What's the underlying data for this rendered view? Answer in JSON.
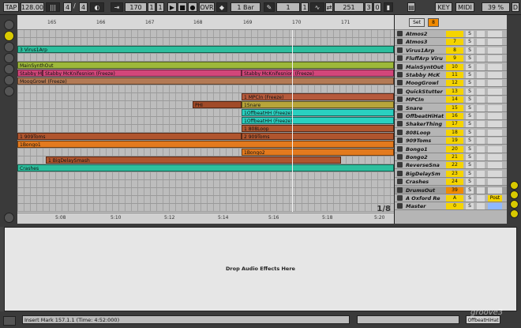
{
  "control_bar": {
    "tap": "TAP",
    "tempo": "128.00",
    "sig_num": "4",
    "sig_slash": "/",
    "sig_den": "4",
    "position_bar": "170",
    "position_beat": "1",
    "position_sub": "1",
    "ovr": "OVR",
    "quantize": "1 Bar",
    "loop_start_bar": "1",
    "loop_start_beat": "1",
    "loop_len_bar": "251",
    "loop_len_beat": "3",
    "loop_len_sub": "0",
    "key": "KEY",
    "midi": "MIDI",
    "cpu": "39 %",
    "d": "D"
  },
  "ruler": [
    "165",
    "166",
    "167",
    "168",
    "169",
    "170",
    "171"
  ],
  "time_ruler": [
    "5:08",
    "5:10",
    "5:12",
    "5:14",
    "5:16",
    "5:18",
    "5:20"
  ],
  "pager": "1/8",
  "set_label": "Set",
  "set_num": "8",
  "clips": [
    {
      "lane": 2,
      "label": "3 Virus1Arp",
      "start": 0,
      "end": 477,
      "color": "#2dbf9e"
    },
    {
      "lane": 4,
      "label": "MainSynthOut",
      "start": 0,
      "end": 477,
      "color": "#9db83a"
    },
    {
      "lane": 5,
      "label": "Stabby Mc",
      "start": 0,
      "end": 32,
      "color": "#d2467a"
    },
    {
      "lane": 5,
      "label": "Stabby McKnifesnion (Freeze)",
      "start": 32,
      "end": 284,
      "color": "#d2467a"
    },
    {
      "lane": 5,
      "label": "Stabby McKnifesnion (Freeze)",
      "start": 284,
      "end": 477,
      "color": "#d2467a"
    },
    {
      "lane": 6,
      "label": "MoogGrowl (Freeze)",
      "start": 0,
      "end": 477,
      "color": "#b37a55"
    },
    {
      "lane": 8,
      "label": "1 MPCIn (Freeze)",
      "start": 284,
      "end": 477,
      "color": "#b55a3c"
    },
    {
      "lane": 9,
      "label": "PHI",
      "start": 222,
      "end": 284,
      "color": "#a04a28"
    },
    {
      "lane": 9,
      "label": "1Snare",
      "start": 284,
      "end": 477,
      "color": "#b8a53a"
    },
    {
      "lane": 10,
      "label": "1OffbeatHH (Freeze)",
      "start": 284,
      "end": 477,
      "color": "#2ad0c0"
    },
    {
      "lane": 11,
      "label": "1OffbeatHH (Freeze)",
      "start": 284,
      "end": 477,
      "color": "#2ad0c0"
    },
    {
      "lane": 12,
      "label": "1 808Loop",
      "start": 284,
      "end": 477,
      "color": "#b0552e"
    },
    {
      "lane": 13,
      "label": "1 909Toms",
      "start": 0,
      "end": 284,
      "color": "#b0552e"
    },
    {
      "lane": 13,
      "label": "2 909Toms",
      "start": 284,
      "end": 477,
      "color": "#b0552e"
    },
    {
      "lane": 14,
      "label": "1Bongo1",
      "start": 0,
      "end": 477,
      "color": "#e37a1e"
    },
    {
      "lane": 15,
      "label": "1Bongo2",
      "start": 284,
      "end": 477,
      "color": "#e37a1e"
    },
    {
      "lane": 16,
      "label": "1 BigDelaySmash",
      "start": 36,
      "end": 410,
      "color": "#b0552e"
    },
    {
      "lane": 17,
      "label": "Crashes",
      "start": 0,
      "end": 477,
      "color": "#2dbf9e"
    }
  ],
  "tracks": [
    {
      "name": "Atmos2",
      "num": "",
      "dark": false
    },
    {
      "name": "Atmos3",
      "num": "7",
      "dark": false
    },
    {
      "name": "Virus1Arp",
      "num": "8",
      "dark": false
    },
    {
      "name": "FluffArp Viru",
      "num": "9",
      "dark": false
    },
    {
      "name": "MainSyntOut",
      "num": "10",
      "dark": false
    },
    {
      "name": "Stabby McK",
      "num": "11",
      "dark": false
    },
    {
      "name": "MoogGrowl",
      "num": "12",
      "dark": false
    },
    {
      "name": "QuickStutter",
      "num": "13",
      "dark": false
    },
    {
      "name": "MPCIn",
      "num": "14",
      "dark": false
    },
    {
      "name": "Snare",
      "num": "15",
      "dark": false
    },
    {
      "name": "OffbeatHiHat",
      "num": "16",
      "dark": false
    },
    {
      "name": "ShakerThing",
      "num": "17",
      "dark": false
    },
    {
      "name": "808Loop",
      "num": "18",
      "dark": false
    },
    {
      "name": "909Toms",
      "num": "19",
      "dark": false
    },
    {
      "name": "Bongo1",
      "num": "20",
      "dark": false
    },
    {
      "name": "Bongo2",
      "num": "21",
      "dark": false
    },
    {
      "name": "ReverseSna",
      "num": "22",
      "dark": false
    },
    {
      "name": "BigDelaySm",
      "num": "23",
      "dark": false
    },
    {
      "name": "Crashes",
      "num": "24",
      "dark": false
    },
    {
      "name": "DrumsOut",
      "num": "39",
      "dark": true
    },
    {
      "name": "A Oxford Re",
      "num": "A",
      "dark": false
    },
    {
      "name": "Master",
      "num": "0",
      "dark": false
    }
  ],
  "mixer_s": "S",
  "post": "Post",
  "device_drop": "Drop Audio Effects Here",
  "status": {
    "text": "Insert Mark 157.1.1 (Time: 4:52:000)",
    "right": "OffbeatHiHat"
  },
  "watermark": "groove3"
}
